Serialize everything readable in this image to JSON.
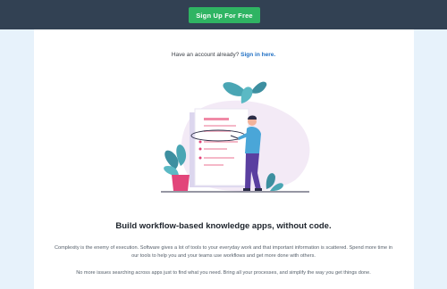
{
  "header": {
    "signup_label": "Sign Up For Free"
  },
  "account": {
    "prompt": "Have an account already?",
    "signin_label": "Sign in here."
  },
  "hero": {
    "illustration": "person-with-checklist-illustration",
    "headline": "Build workflow-based knowledge apps, without code."
  },
  "body": {
    "paragraph_1": "Complexity is the enemy of execution. Software gives a lot of tools to your everyday work and that important information is scattered. Spend more time in our tools to help you and your teams use workflows and get more done with others.",
    "paragraph_2": "No more issues searching across apps just to find what you need. Bring all your processes, and simplify the way you get things done."
  },
  "colors": {
    "topbar": "#324153",
    "accent_green": "#2fb463",
    "link_blue": "#1f6fc4",
    "page_bg": "#e7f2fb"
  }
}
